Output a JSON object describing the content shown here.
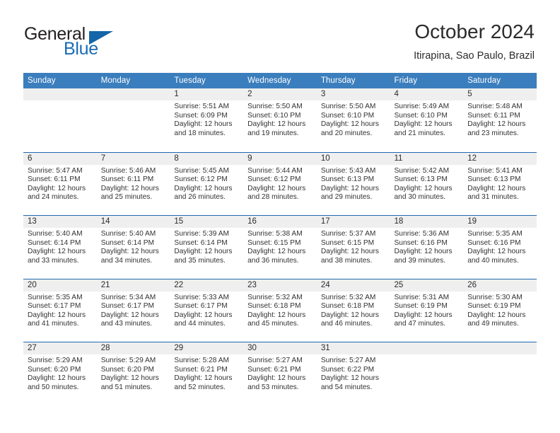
{
  "brand": {
    "name_top": "General",
    "name_bottom": "Blue",
    "flag_icon": "triangle-flag-icon",
    "accent_color": "#1565a8",
    "text_color": "#231f20"
  },
  "header": {
    "title": "October 2024",
    "subtitle": "Itirapina, Sao Paulo, Brazil"
  },
  "calendar": {
    "header_bg": "#3b7ebd",
    "row_divider_color": "#1f6ab0",
    "date_strip_bg": "#efefef",
    "weekdays": [
      "Sunday",
      "Monday",
      "Tuesday",
      "Wednesday",
      "Thursday",
      "Friday",
      "Saturday"
    ],
    "weeks": [
      [
        {
          "day": "",
          "empty": true,
          "lines": []
        },
        {
          "day": "",
          "empty": true,
          "lines": []
        },
        {
          "day": "1",
          "empty": false,
          "lines": [
            "Sunrise: 5:51 AM",
            "Sunset: 6:09 PM",
            "Daylight: 12 hours",
            "and 18 minutes."
          ]
        },
        {
          "day": "2",
          "empty": false,
          "lines": [
            "Sunrise: 5:50 AM",
            "Sunset: 6:10 PM",
            "Daylight: 12 hours",
            "and 19 minutes."
          ]
        },
        {
          "day": "3",
          "empty": false,
          "lines": [
            "Sunrise: 5:50 AM",
            "Sunset: 6:10 PM",
            "Daylight: 12 hours",
            "and 20 minutes."
          ]
        },
        {
          "day": "4",
          "empty": false,
          "lines": [
            "Sunrise: 5:49 AM",
            "Sunset: 6:10 PM",
            "Daylight: 12 hours",
            "and 21 minutes."
          ]
        },
        {
          "day": "5",
          "empty": false,
          "lines": [
            "Sunrise: 5:48 AM",
            "Sunset: 6:11 PM",
            "Daylight: 12 hours",
            "and 23 minutes."
          ]
        }
      ],
      [
        {
          "day": "6",
          "empty": false,
          "lines": [
            "Sunrise: 5:47 AM",
            "Sunset: 6:11 PM",
            "Daylight: 12 hours",
            "and 24 minutes."
          ]
        },
        {
          "day": "7",
          "empty": false,
          "lines": [
            "Sunrise: 5:46 AM",
            "Sunset: 6:11 PM",
            "Daylight: 12 hours",
            "and 25 minutes."
          ]
        },
        {
          "day": "8",
          "empty": false,
          "lines": [
            "Sunrise: 5:45 AM",
            "Sunset: 6:12 PM",
            "Daylight: 12 hours",
            "and 26 minutes."
          ]
        },
        {
          "day": "9",
          "empty": false,
          "lines": [
            "Sunrise: 5:44 AM",
            "Sunset: 6:12 PM",
            "Daylight: 12 hours",
            "and 28 minutes."
          ]
        },
        {
          "day": "10",
          "empty": false,
          "lines": [
            "Sunrise: 5:43 AM",
            "Sunset: 6:13 PM",
            "Daylight: 12 hours",
            "and 29 minutes."
          ]
        },
        {
          "day": "11",
          "empty": false,
          "lines": [
            "Sunrise: 5:42 AM",
            "Sunset: 6:13 PM",
            "Daylight: 12 hours",
            "and 30 minutes."
          ]
        },
        {
          "day": "12",
          "empty": false,
          "lines": [
            "Sunrise: 5:41 AM",
            "Sunset: 6:13 PM",
            "Daylight: 12 hours",
            "and 31 minutes."
          ]
        }
      ],
      [
        {
          "day": "13",
          "empty": false,
          "lines": [
            "Sunrise: 5:40 AM",
            "Sunset: 6:14 PM",
            "Daylight: 12 hours",
            "and 33 minutes."
          ]
        },
        {
          "day": "14",
          "empty": false,
          "lines": [
            "Sunrise: 5:40 AM",
            "Sunset: 6:14 PM",
            "Daylight: 12 hours",
            "and 34 minutes."
          ]
        },
        {
          "day": "15",
          "empty": false,
          "lines": [
            "Sunrise: 5:39 AM",
            "Sunset: 6:14 PM",
            "Daylight: 12 hours",
            "and 35 minutes."
          ]
        },
        {
          "day": "16",
          "empty": false,
          "lines": [
            "Sunrise: 5:38 AM",
            "Sunset: 6:15 PM",
            "Daylight: 12 hours",
            "and 36 minutes."
          ]
        },
        {
          "day": "17",
          "empty": false,
          "lines": [
            "Sunrise: 5:37 AM",
            "Sunset: 6:15 PM",
            "Daylight: 12 hours",
            "and 38 minutes."
          ]
        },
        {
          "day": "18",
          "empty": false,
          "lines": [
            "Sunrise: 5:36 AM",
            "Sunset: 6:16 PM",
            "Daylight: 12 hours",
            "and 39 minutes."
          ]
        },
        {
          "day": "19",
          "empty": false,
          "lines": [
            "Sunrise: 5:35 AM",
            "Sunset: 6:16 PM",
            "Daylight: 12 hours",
            "and 40 minutes."
          ]
        }
      ],
      [
        {
          "day": "20",
          "empty": false,
          "lines": [
            "Sunrise: 5:35 AM",
            "Sunset: 6:17 PM",
            "Daylight: 12 hours",
            "and 41 minutes."
          ]
        },
        {
          "day": "21",
          "empty": false,
          "lines": [
            "Sunrise: 5:34 AM",
            "Sunset: 6:17 PM",
            "Daylight: 12 hours",
            "and 43 minutes."
          ]
        },
        {
          "day": "22",
          "empty": false,
          "lines": [
            "Sunrise: 5:33 AM",
            "Sunset: 6:17 PM",
            "Daylight: 12 hours",
            "and 44 minutes."
          ]
        },
        {
          "day": "23",
          "empty": false,
          "lines": [
            "Sunrise: 5:32 AM",
            "Sunset: 6:18 PM",
            "Daylight: 12 hours",
            "and 45 minutes."
          ]
        },
        {
          "day": "24",
          "empty": false,
          "lines": [
            "Sunrise: 5:32 AM",
            "Sunset: 6:18 PM",
            "Daylight: 12 hours",
            "and 46 minutes."
          ]
        },
        {
          "day": "25",
          "empty": false,
          "lines": [
            "Sunrise: 5:31 AM",
            "Sunset: 6:19 PM",
            "Daylight: 12 hours",
            "and 47 minutes."
          ]
        },
        {
          "day": "26",
          "empty": false,
          "lines": [
            "Sunrise: 5:30 AM",
            "Sunset: 6:19 PM",
            "Daylight: 12 hours",
            "and 49 minutes."
          ]
        }
      ],
      [
        {
          "day": "27",
          "empty": false,
          "lines": [
            "Sunrise: 5:29 AM",
            "Sunset: 6:20 PM",
            "Daylight: 12 hours",
            "and 50 minutes."
          ]
        },
        {
          "day": "28",
          "empty": false,
          "lines": [
            "Sunrise: 5:29 AM",
            "Sunset: 6:20 PM",
            "Daylight: 12 hours",
            "and 51 minutes."
          ]
        },
        {
          "day": "29",
          "empty": false,
          "lines": [
            "Sunrise: 5:28 AM",
            "Sunset: 6:21 PM",
            "Daylight: 12 hours",
            "and 52 minutes."
          ]
        },
        {
          "day": "30",
          "empty": false,
          "lines": [
            "Sunrise: 5:27 AM",
            "Sunset: 6:21 PM",
            "Daylight: 12 hours",
            "and 53 minutes."
          ]
        },
        {
          "day": "31",
          "empty": false,
          "lines": [
            "Sunrise: 5:27 AM",
            "Sunset: 6:22 PM",
            "Daylight: 12 hours",
            "and 54 minutes."
          ]
        },
        {
          "day": "",
          "empty": true,
          "lines": []
        },
        {
          "day": "",
          "empty": true,
          "lines": []
        }
      ]
    ]
  }
}
